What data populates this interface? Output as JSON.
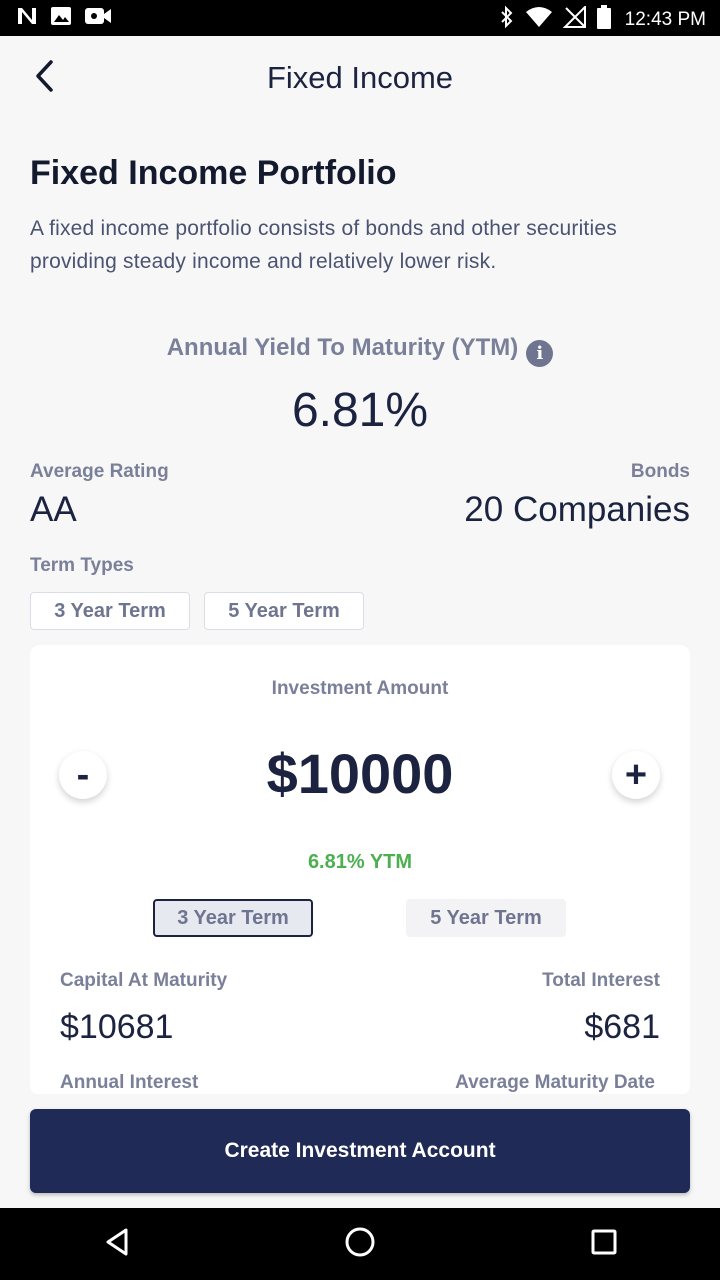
{
  "status_bar": {
    "time": "12:43 PM",
    "left_icons": [
      "n-icon",
      "image-icon",
      "video-icon"
    ],
    "right_icons": [
      "bluetooth-icon",
      "wifi-icon",
      "no-signal-icon",
      "battery-icon"
    ]
  },
  "appbar": {
    "title": "Fixed Income",
    "back_icon": "chevron-left-icon"
  },
  "portfolio": {
    "title": "Fixed Income Portfolio",
    "description": "A fixed income portfolio consists of bonds and other securities providing steady income and relatively lower risk."
  },
  "ytm": {
    "label": "Annual Yield To Maturity (YTM)",
    "info_icon_glyph": "i",
    "value": "6.81%"
  },
  "average_rating": {
    "label": "Average Rating",
    "value": "AA"
  },
  "bonds": {
    "label": "Bonds",
    "value": "20 Companies"
  },
  "term_types": {
    "label": "Term Types",
    "options": [
      "3 Year Term",
      "5 Year Term"
    ]
  },
  "calculator": {
    "investment_label": "Investment Amount",
    "minus_label": "-",
    "plus_label": "+",
    "amount": "$10000",
    "ytm_note": "6.81% YTM",
    "terms": [
      "3 Year Term",
      "5 Year Term"
    ],
    "selected_term": "3 Year Term",
    "capital_label": "Capital At Maturity",
    "capital_value": "$10681",
    "total_interest_label": "Total Interest",
    "total_interest_value": "$681",
    "annual_interest_label": "Annual Interest",
    "avg_maturity_label": "Average Maturity Date"
  },
  "cta": {
    "label": "Create Investment Account"
  },
  "colors": {
    "primary": "#1f2a56",
    "accent_green": "#4caf50",
    "muted_text": "#7a8099",
    "dark_text": "#1b2340"
  },
  "nav_bar": {
    "icons": [
      "back-triangle-icon",
      "home-circle-icon",
      "recents-square-icon"
    ]
  }
}
